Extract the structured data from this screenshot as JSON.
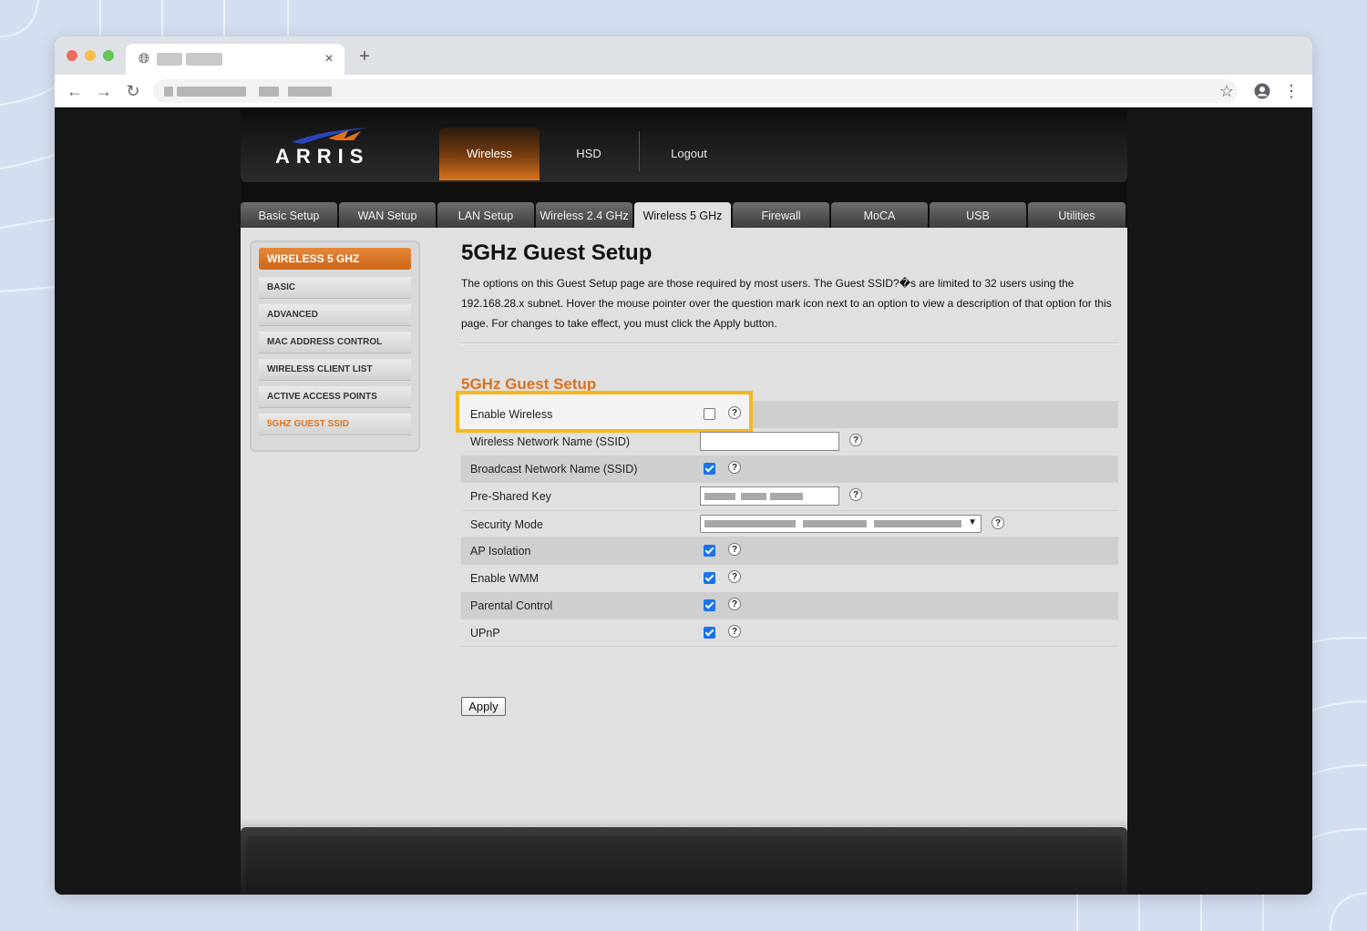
{
  "browser": {
    "tab_close_glyph": "×",
    "new_tab_glyph": "+",
    "icons": [
      "globe-icon",
      "back-icon",
      "forward-icon",
      "reload-icon",
      "star-icon",
      "profile-icon",
      "menu-icon"
    ]
  },
  "header": {
    "logo": "ARRIS",
    "nav": [
      "Wireless",
      "HSD",
      "Logout"
    ],
    "active_nav": "Wireless"
  },
  "tabs": [
    "Basic Setup",
    "WAN Setup",
    "LAN Setup",
    "Wireless 2.4 GHz",
    "Wireless 5 GHz",
    "Firewall",
    "MoCA",
    "USB",
    "Utilities"
  ],
  "active_tab": "Wireless 5 GHz",
  "sidebar": {
    "title": "WIRELESS 5 GHZ",
    "items": [
      "BASIC",
      "ADVANCED",
      "MAC ADDRESS CONTROL",
      "WIRELESS CLIENT LIST",
      "ACTIVE ACCESS POINTS",
      "5GHZ GUEST SSID"
    ],
    "active_item": "5GHZ GUEST SSID"
  },
  "main": {
    "title": "5GHz Guest Setup",
    "intro": "The options on this Guest Setup page are those required by most users. The Guest SSID?�s are limited to 32 users using the 192.168.28.x subnet. Hover the mouse pointer over the question mark icon next to an option to view a description of that option for this page. For changes to take effect, you must click the Apply button.",
    "section_title": "5GHz Guest Setup",
    "help_glyph": "?",
    "fields": [
      {
        "label": "Enable Wireless",
        "type": "checkbox",
        "checked": false
      },
      {
        "label": "Wireless Network Name (SSID)",
        "type": "text",
        "value": ""
      },
      {
        "label": "Broadcast Network Name (SSID)",
        "type": "checkbox",
        "checked": true
      },
      {
        "label": "Pre-Shared Key",
        "type": "text",
        "value": "(blurred)"
      },
      {
        "label": "Security Mode",
        "type": "select",
        "value": "(blurred)"
      },
      {
        "label": "AP Isolation",
        "type": "checkbox",
        "checked": true
      },
      {
        "label": "Enable WMM",
        "type": "checkbox",
        "checked": true
      },
      {
        "label": "Parental Control",
        "type": "checkbox",
        "checked": true
      },
      {
        "label": "UPnP",
        "type": "checkbox",
        "checked": true
      }
    ],
    "apply_label": "Apply"
  },
  "colors": {
    "accent_orange": "#d9731e",
    "highlight_yellow": "#f5b820",
    "checkbox_blue": "#1a73e8"
  }
}
